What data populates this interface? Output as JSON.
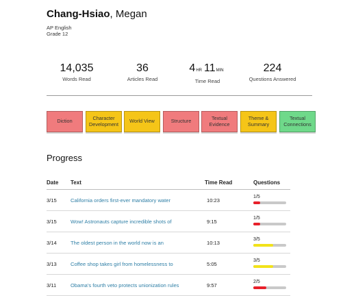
{
  "student": {
    "last_name": "Chang-Hsiao",
    "separator": ",",
    "first_name": "Megan",
    "course": "AP English",
    "grade": "Grade 12"
  },
  "stats": {
    "words_read": {
      "value": "14,035",
      "label": "Words Read"
    },
    "articles_read": {
      "value": "36",
      "label": "Articles Read"
    },
    "time_read": {
      "hours": "4",
      "hours_unit": "HR",
      "minutes": "11",
      "minutes_unit": "MIN",
      "label": "Time Read"
    },
    "questions_answered": {
      "value": "224",
      "label": "Questions Answered"
    }
  },
  "skills": [
    {
      "label": "Diction",
      "color": "#f07b7d"
    },
    {
      "label": "Character Development",
      "color": "#f5c518"
    },
    {
      "label": "World View",
      "color": "#f5c518"
    },
    {
      "label": "Structure",
      "color": "#f07b7d"
    },
    {
      "label": "Textual Evidence",
      "color": "#f07b7d"
    },
    {
      "label": "Theme & Summary",
      "color": "#f5c518"
    },
    {
      "label": "Textual Connections",
      "color": "#6fd98a"
    }
  ],
  "progress": {
    "title": "Progress",
    "columns": {
      "date": "Date",
      "text": "Text",
      "time_read": "Time Read",
      "questions": "Questions"
    },
    "rows": [
      {
        "date": "3/15",
        "text": "California orders first-ever mandatory water",
        "time": "10:23",
        "questions": "1/5",
        "score": 0.2,
        "bar_color": "#e8202a"
      },
      {
        "date": "3/15",
        "text": "Wow! Astronauts capture incredible shots of",
        "time": "9:15",
        "questions": "1/5",
        "score": 0.2,
        "bar_color": "#e8202a"
      },
      {
        "date": "3/14",
        "text": "The oldest person in the world now is an",
        "time": "10:13",
        "questions": "3/5",
        "score": 0.6,
        "bar_color": "#f2e21a"
      },
      {
        "date": "3/13",
        "text": "Coffee shop takes girl from homelessness to",
        "time": "5:05",
        "questions": "3/5",
        "score": 0.6,
        "bar_color": "#f2e21a"
      },
      {
        "date": "3/11",
        "text": "Obama's fourth veto protects unionization rules",
        "time": "9:57",
        "questions": "2/5",
        "score": 0.4,
        "bar_color": "#e8202a"
      }
    ]
  }
}
